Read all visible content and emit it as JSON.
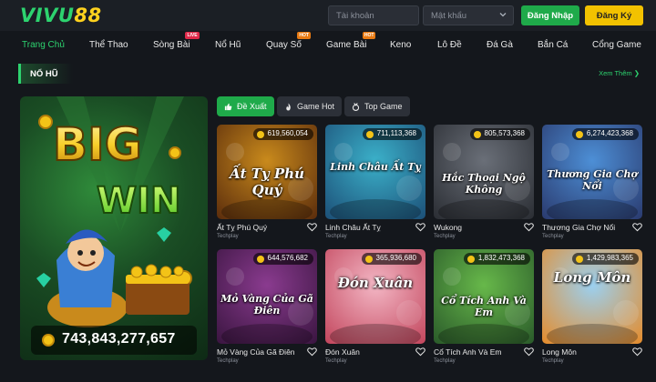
{
  "header": {
    "logo_green": "VIVU",
    "logo_yellow": "88",
    "username_placeholder": "Tài khoản",
    "password_placeholder": "Mật khẩu",
    "login_label": "Đăng Nhập",
    "register_label": "Đăng Ký"
  },
  "nav": {
    "items": [
      {
        "label": "Trang Chủ",
        "active": true
      },
      {
        "label": "Thể Thao"
      },
      {
        "label": "Sòng Bài",
        "badge": "LIVE"
      },
      {
        "label": "Nổ Hũ"
      },
      {
        "label": "Quay Số",
        "badge": "HOT"
      },
      {
        "label": "Game Bài",
        "badge": "HOT"
      },
      {
        "label": "Keno"
      },
      {
        "label": "Lô Đề"
      },
      {
        "label": "Đá Gà"
      },
      {
        "label": "Bắn Cá"
      },
      {
        "label": "Cổng Game"
      }
    ]
  },
  "section": {
    "title": "NỔ HŨ",
    "see_more": "Xem Thêm"
  },
  "bigwin": {
    "line1": "BIG",
    "line2": "WIN",
    "jackpot": "743,843,277,657"
  },
  "tabs": [
    {
      "label": "Đề Xuất",
      "icon": "thumbs-up-icon",
      "active": true
    },
    {
      "label": "Game Hot",
      "icon": "flame-icon"
    },
    {
      "label": "Top Game",
      "icon": "medal-icon"
    }
  ],
  "games": [
    {
      "name": "Ất Tỵ Phú Quý",
      "provider": "Techplay",
      "jackpot": "619,560,054",
      "art": "Ất Tỵ Phú Quý",
      "color1": "#c98a1c",
      "color2": "#5a2c0c"
    },
    {
      "name": "Linh Châu Ất Tỵ",
      "provider": "Techplay",
      "jackpot": "711,113,368",
      "art": "Linh Châu Ất Tỵ",
      "color1": "#3bb0c9",
      "color2": "#1c4f77"
    },
    {
      "name": "Wukong",
      "provider": "Techplay",
      "jackpot": "805,573,368",
      "art": "Hắc Thoại Ngộ Không",
      "color1": "#6a6f78",
      "color2": "#2a2d33"
    },
    {
      "name": "Thương Gia Chợ Nổi",
      "provider": "Techplay",
      "jackpot": "6,274,423,368",
      "art": "Thương Gia Chợ Nổi",
      "color1": "#4d8fd6",
      "color2": "#2a3a6e"
    },
    {
      "name": "Mỏ Vàng Của Gã Điên",
      "provider": "Techplay",
      "jackpot": "644,576,682",
      "art": "Mỏ Vàng Của Gã Điên",
      "color1": "#8a3b8f",
      "color2": "#3a1540"
    },
    {
      "name": "Đón Xuân",
      "provider": "Techplay",
      "jackpot": "365,936,680",
      "art": "Đón Xuân",
      "color1": "#f3b6c4",
      "color2": "#c2455c"
    },
    {
      "name": "Cổ Tích Anh Và Em",
      "provider": "Techplay",
      "jackpot": "1,832,473,368",
      "art": "Cổ Tích Anh Và Em",
      "color1": "#67b84a",
      "color2": "#2a5a2a"
    },
    {
      "name": "Long Môn",
      "provider": "Techplay",
      "jackpot": "1,429,983,365",
      "art": "Long Môn",
      "color1": "#9bd0f0",
      "color2": "#e58b2a"
    }
  ]
}
